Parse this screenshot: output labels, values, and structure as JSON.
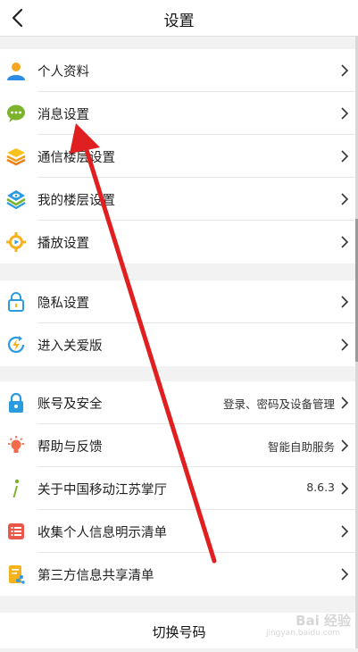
{
  "header": {
    "title": "设置",
    "back_icon": "chevron-left-icon"
  },
  "group1": [
    {
      "label": "个人资料",
      "icon": "person-icon"
    },
    {
      "label": "消息设置",
      "icon": "chat-bubble-icon"
    },
    {
      "label": "通信楼层设置",
      "icon": "stacked-layers-icon"
    },
    {
      "label": "我的楼层设置",
      "icon": "layers-eye-icon"
    },
    {
      "label": "播放设置",
      "icon": "gear-play-icon"
    }
  ],
  "group2": [
    {
      "label": "隐私设置",
      "icon": "padlock-icon"
    },
    {
      "label": "进入关爱版",
      "icon": "lightning-refresh-icon"
    }
  ],
  "group3": [
    {
      "label": "账号及安全",
      "icon": "lock-icon",
      "value": "登录、密码及设备管理"
    },
    {
      "label": "帮助与反馈",
      "icon": "lightbulb-icon",
      "value": "智能自助服务"
    },
    {
      "label": "关于中国移动江苏掌厅",
      "icon": "info-icon",
      "value": "8.6.3"
    },
    {
      "label": "收集个人信息明示清单",
      "icon": "list-icon"
    },
    {
      "label": "第三方信息共享清单",
      "icon": "share-doc-icon"
    }
  ],
  "bottom_button": {
    "label": "切换号码"
  },
  "watermark": {
    "text": "Bai 经验",
    "sub": "jingyan.baidu.com"
  },
  "colors": {
    "annotation_arrow": "#e02020",
    "background": "#f2f2f2",
    "card": "#ffffff"
  }
}
